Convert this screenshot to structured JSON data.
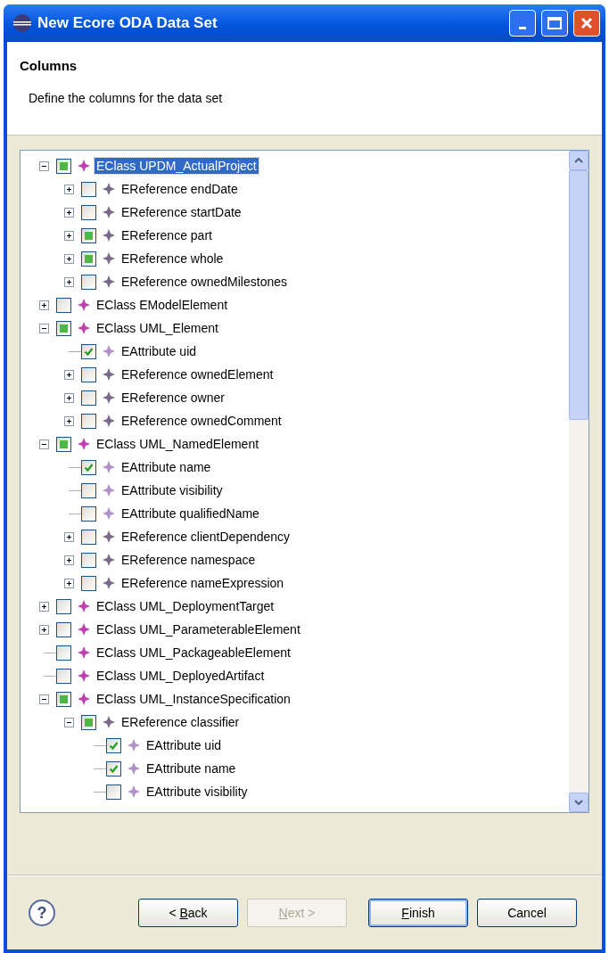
{
  "window": {
    "title": "New Ecore ODA Data Set"
  },
  "header": {
    "title": "Columns",
    "description": "Define the columns for the data set"
  },
  "tree": [
    {
      "kind": "eclass",
      "label": "EClass UPDM_ActualProject",
      "checked": false,
      "grayed": true,
      "selected": true,
      "expanded": true,
      "children": [
        {
          "kind": "ereference",
          "label": "EReference endDate",
          "checked": false,
          "grayed": false,
          "selected": false,
          "expanded": false
        },
        {
          "kind": "ereference",
          "label": "EReference startDate",
          "checked": false,
          "grayed": false,
          "selected": false,
          "expanded": false
        },
        {
          "kind": "ereference",
          "label": "EReference part",
          "checked": false,
          "grayed": true,
          "selected": false,
          "expanded": false
        },
        {
          "kind": "ereference",
          "label": "EReference whole",
          "checked": false,
          "grayed": true,
          "selected": false,
          "expanded": false
        },
        {
          "kind": "ereference",
          "label": "EReference ownedMilestones",
          "checked": false,
          "grayed": false,
          "selected": false,
          "expanded": false
        }
      ]
    },
    {
      "kind": "eclass",
      "label": "EClass EModelElement",
      "checked": false,
      "grayed": false,
      "selected": false,
      "expanded": false
    },
    {
      "kind": "eclass",
      "label": "EClass UML_Element",
      "checked": false,
      "grayed": true,
      "selected": false,
      "expanded": true,
      "children": [
        {
          "kind": "eattribute",
          "label": "EAttribute uid",
          "checked": true,
          "grayed": false,
          "selected": false
        },
        {
          "kind": "ereference",
          "label": "EReference ownedElement",
          "checked": false,
          "grayed": false,
          "selected": false,
          "expanded": false
        },
        {
          "kind": "ereference",
          "label": "EReference owner",
          "checked": false,
          "grayed": false,
          "selected": false,
          "expanded": false
        },
        {
          "kind": "ereference",
          "label": "EReference ownedComment",
          "checked": false,
          "grayed": false,
          "selected": false,
          "expanded": false
        }
      ]
    },
    {
      "kind": "eclass",
      "label": "EClass UML_NamedElement",
      "checked": false,
      "grayed": true,
      "selected": false,
      "expanded": true,
      "children": [
        {
          "kind": "eattribute",
          "label": "EAttribute name",
          "checked": true,
          "grayed": false,
          "selected": false
        },
        {
          "kind": "eattribute",
          "label": "EAttribute visibility",
          "checked": false,
          "grayed": false,
          "selected": false
        },
        {
          "kind": "eattribute",
          "label": "EAttribute qualifiedName",
          "checked": false,
          "grayed": false,
          "selected": false
        },
        {
          "kind": "ereference",
          "label": "EReference clientDependency",
          "checked": false,
          "grayed": false,
          "selected": false,
          "expanded": false
        },
        {
          "kind": "ereference",
          "label": "EReference namespace",
          "checked": false,
          "grayed": false,
          "selected": false,
          "expanded": false
        },
        {
          "kind": "ereference",
          "label": "EReference nameExpression",
          "checked": false,
          "grayed": false,
          "selected": false,
          "expanded": false
        }
      ]
    },
    {
      "kind": "eclass",
      "label": "EClass UML_DeploymentTarget",
      "checked": false,
      "grayed": false,
      "selected": false,
      "expanded": false
    },
    {
      "kind": "eclass",
      "label": "EClass UML_ParameterableElement",
      "checked": false,
      "grayed": false,
      "selected": false,
      "expanded": false
    },
    {
      "kind": "eclass",
      "label": "EClass UML_PackageableElement",
      "checked": false,
      "grayed": false,
      "selected": false
    },
    {
      "kind": "eclass",
      "label": "EClass UML_DeployedArtifact",
      "checked": false,
      "grayed": false,
      "selected": false
    },
    {
      "kind": "eclass",
      "label": "EClass UML_InstanceSpecification",
      "checked": false,
      "grayed": true,
      "selected": false,
      "expanded": true,
      "children": [
        {
          "kind": "ereference",
          "label": "EReference classifier",
          "checked": false,
          "grayed": true,
          "selected": false,
          "expanded": true,
          "children": [
            {
              "kind": "eattribute",
              "label": "EAttribute uid",
              "checked": true,
              "grayed": false,
              "selected": false
            },
            {
              "kind": "eattribute",
              "label": "EAttribute name",
              "checked": true,
              "grayed": false,
              "selected": false
            },
            {
              "kind": "eattribute",
              "label": "EAttribute visibility",
              "checked": false,
              "grayed": false,
              "selected": false
            }
          ]
        }
      ]
    }
  ],
  "help": {
    "label": "?"
  },
  "buttons": [
    {
      "before": "< ",
      "key": "B",
      "after": "ack",
      "disabled": false,
      "default": false
    },
    {
      "key": "N",
      "after": "ext >",
      "disabled": true,
      "default": false
    },
    {
      "key": "F",
      "after": "inish",
      "disabled": false,
      "default": true
    },
    {
      "after": "Cancel",
      "disabled": false,
      "default": false
    }
  ]
}
